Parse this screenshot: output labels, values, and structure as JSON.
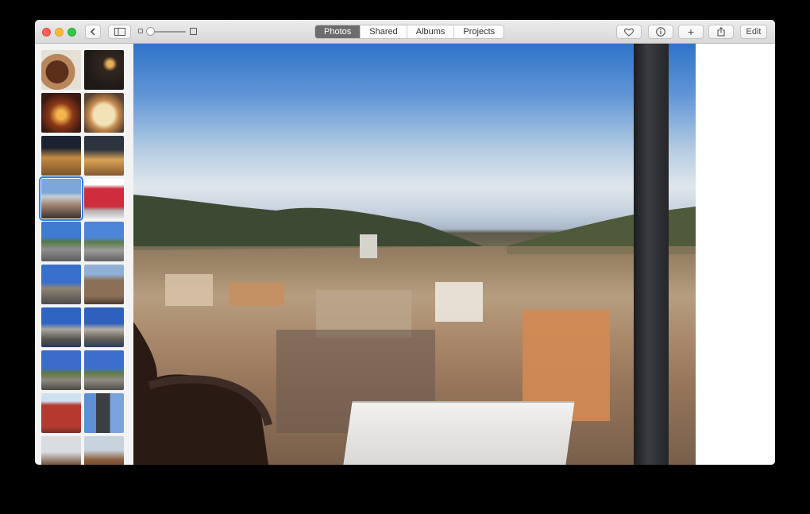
{
  "toolbar": {
    "tabs": [
      {
        "label": "Photos",
        "active": true
      },
      {
        "label": "Shared",
        "active": false
      },
      {
        "label": "Albums",
        "active": false
      },
      {
        "label": "Projects",
        "active": false
      }
    ],
    "edit_label": "Edit",
    "add_symbol": "+",
    "icons": {
      "back": "chevron-left-icon",
      "sidebar": "sidebar-toggle-icon",
      "favorite": "heart-icon",
      "info": "info-icon",
      "add": "plus-icon",
      "share": "share-icon"
    }
  },
  "zoom_slider": {
    "level": 0.05
  },
  "sidebar": {
    "selected_index": 6,
    "thumbnail_count": 20
  },
  "colors": {
    "accent": "#2a7fe5",
    "active_tab": "#6d6d6d"
  }
}
